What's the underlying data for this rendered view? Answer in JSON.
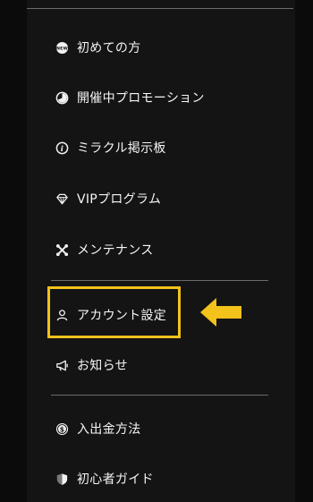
{
  "menu": {
    "items": [
      {
        "label": "初めての方",
        "icon": "new-badge-icon"
      },
      {
        "label": "開催中プロモーション",
        "icon": "pie-chart-icon"
      },
      {
        "label": "ミラクル掲示板",
        "icon": "info-icon"
      },
      {
        "label": "VIPプログラム",
        "icon": "diamond-icon"
      },
      {
        "label": "メンテナンス",
        "icon": "tools-icon"
      },
      {
        "label": "アカウント設定",
        "icon": "user-icon"
      },
      {
        "label": "お知らせ",
        "icon": "megaphone-icon"
      },
      {
        "label": "入出金方法",
        "icon": "coin-icon"
      },
      {
        "label": "初心者ガイド",
        "icon": "shield-icon"
      }
    ]
  },
  "annotation": {
    "highlight_color": "#f3c21b",
    "arrow_color": "#f3c21b",
    "highlighted_item": "アカウント設定"
  },
  "colors": {
    "background": "#0b0b0b",
    "panel": "#141414",
    "divider": "#6b6b6b",
    "text": "#f5f5f5"
  }
}
